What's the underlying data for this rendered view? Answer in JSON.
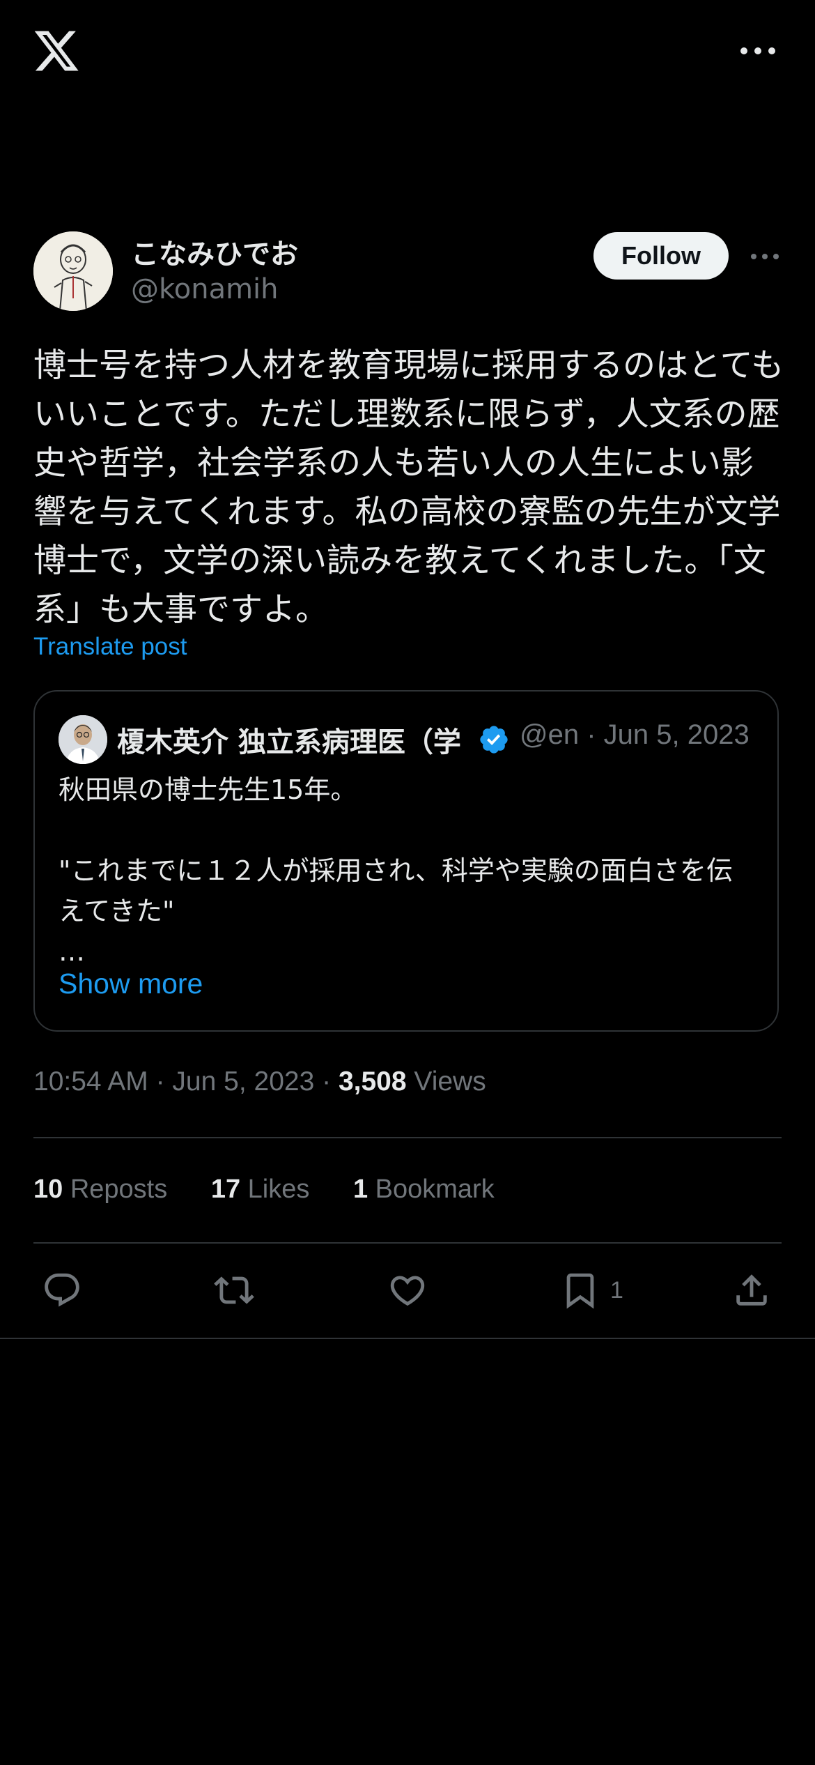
{
  "app": {
    "name": "X"
  },
  "header": {
    "logo_icon": "x-logo-icon",
    "more_icon": "more-horizontal-icon"
  },
  "post": {
    "author": {
      "display_name": "こなみひでお",
      "handle": "@konamih",
      "avatar_icon": "avatar-caricature"
    },
    "follow_label": "Follow",
    "text": "博士号を持つ人材を教育現場に採用するのはとてもいいことです。ただし理数系に限らず，人文系の歴史や哲学，社会学系の人も若い人の人生によい影響を与えてくれます。私の高校の寮監の先生が文学博士で，文学の深い読みを教えてくれました。「文系」も大事ですよ。",
    "translate_label": "Translate post",
    "quote": {
      "display_name": "榎木英介 独立系病理医（学",
      "handle_date": "@en · Jun 5, 2023",
      "verified_icon": "verified-badge-icon",
      "text": "秋田県の博士先生15年。\n\n\"これまでに１２人が採用され、科学や実験の面白さを伝えてきた\"\n…",
      "show_more_label": "Show more"
    },
    "timestamp": "10:54 AM · Jun 5, 2023 · ",
    "views_count": "3,508",
    "views_label": " Views",
    "stats": {
      "reposts_count": "10",
      "reposts_label": " Reposts",
      "likes_count": "17",
      "likes_label": " Likes",
      "bookmarks_count": "1",
      "bookmarks_label": " Bookmark"
    },
    "actions": {
      "reply_icon": "reply-icon",
      "repost_icon": "repost-icon",
      "like_icon": "heart-icon",
      "bookmark_icon": "bookmark-icon",
      "bookmark_count": "1",
      "share_icon": "share-icon"
    }
  },
  "colors": {
    "background": "#000000",
    "text_primary": "#e7e9ea",
    "text_secondary": "#71767b",
    "accent_blue": "#1d9bf0",
    "divider": "#2f3336",
    "follow_bg": "#eff3f4"
  }
}
